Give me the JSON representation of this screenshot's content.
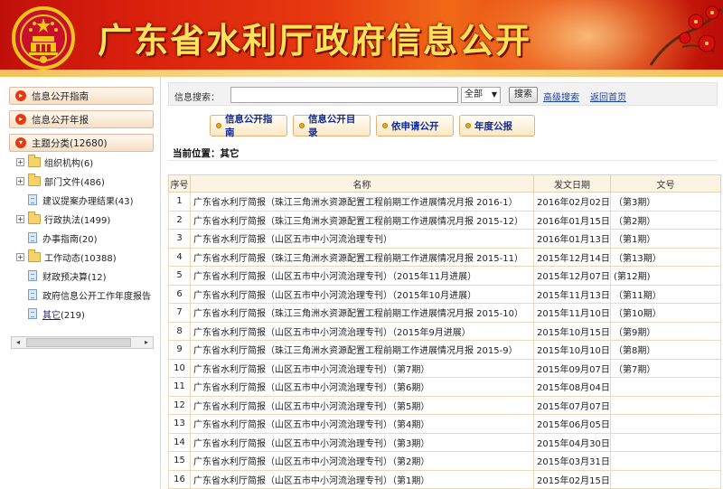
{
  "banner": {
    "title": "广东省水利厅政府信息公开"
  },
  "sidebar": {
    "guide_btn": "信息公开指南",
    "annual_btn": "信息公开年报",
    "topic_btn": "主题分类(12680)",
    "tree": [
      {
        "label": "组织机构(6)",
        "type": "folder",
        "expandable": true
      },
      {
        "label": "部门文件(486)",
        "type": "folder",
        "expandable": true
      },
      {
        "label": "建议提案办理结果(43)",
        "type": "doc",
        "expandable": false
      },
      {
        "label": "行政执法(1499)",
        "type": "folder",
        "expandable": true
      },
      {
        "label": "办事指南(20)",
        "type": "doc",
        "expandable": false
      },
      {
        "label": "工作动态(10388)",
        "type": "folder",
        "expandable": true
      },
      {
        "label": "财政预决算(12)",
        "type": "doc",
        "expandable": false
      },
      {
        "label": "政府信息公开工作年度报告",
        "type": "doc",
        "expandable": false
      }
    ],
    "selected": {
      "link": "其它",
      "count": "(219)"
    }
  },
  "search": {
    "label": "信息搜索：",
    "input_value": "",
    "scope_value": "全部",
    "button": "搜索",
    "advanced_link": "高级搜索",
    "home_link": "返回首页"
  },
  "tabs": [
    "信息公开指南",
    "信息公开目录",
    "依申请公开",
    "年度公报"
  ],
  "breadcrumb": "当前位置：其它",
  "table": {
    "headers": [
      "序号",
      "名称",
      "发文日期",
      "文号"
    ],
    "rows": [
      [
        "1",
        "广东省水利厅简报（珠江三角洲水资源配置工程前期工作进展情况月报 2016-1）",
        "2016年02月02日",
        "（第3期）"
      ],
      [
        "2",
        "广东省水利厅简报（珠江三角洲水资源配置工程前期工作进展情况月报 2015-12）",
        "2016年01月15日",
        "（第2期）"
      ],
      [
        "3",
        "广东省水利厅简报（山区五市中小河流治理专刊）",
        "2016年01月13日",
        "（第1期）"
      ],
      [
        "4",
        "广东省水利厅简报（珠江三角洲水资源配置工程前期工作进展情况月报 2015-11）",
        "2015年12月14日",
        "（第13期）"
      ],
      [
        "5",
        "广东省水利厅简报（山区五市中小河流治理专刊）（2015年11月进展）",
        "2015年12月07日",
        "(第12期)"
      ],
      [
        "6",
        "广东省水利厅简报（山区五市中小河流治理专刊）（2015年10月进展）",
        "2015年11月13日",
        "（第11期）"
      ],
      [
        "7",
        "广东省水利厅简报（珠江三角洲水资源配置工程前期工作进展情况月报 2015-10）",
        "2015年11月10日",
        "（第10期）"
      ],
      [
        "8",
        "广东省水利厅简报（山区五市中小河流治理专刊）（2015年9月进展）",
        "2015年10月15日",
        "（第9期）"
      ],
      [
        "9",
        "广东省水利厅简报（珠江三角洲水资源配置工程前期工作进展情况月报 2015-9）",
        "2015年10月10日",
        "（第8期）"
      ],
      [
        "10",
        "广东省水利厅简报（山区五市中小河流治理专刊）（第7期）",
        "2015年09月07日",
        "（第7期）"
      ],
      [
        "11",
        "广东省水利厅简报（山区五市中小河流治理专刊）（第6期）",
        "2015年08月04日",
        ""
      ],
      [
        "12",
        "广东省水利厅简报（山区五市中小河流治理专刊）（第5期）",
        "2015年07月07日",
        ""
      ],
      [
        "13",
        "广东省水利厅简报（山区五市中小河流治理专刊）（第4期）",
        "2015年06月05日",
        ""
      ],
      [
        "14",
        "广东省水利厅简报（山区五市中小河流治理专刊）（第3期）",
        "2015年04月30日",
        ""
      ],
      [
        "15",
        "广东省水利厅简报（山区五市中小河流治理专刊）（第2期）",
        "2015年03月31日",
        ""
      ],
      [
        "16",
        "广东省水利厅简报（山区五市中小河流治理专刊）（第1期）",
        "2015年02月15日",
        ""
      ]
    ]
  },
  "colors": {
    "banner_red": "#d8200c",
    "title_gold": "#ffe45a",
    "link_blue": "#1a3fb0"
  }
}
